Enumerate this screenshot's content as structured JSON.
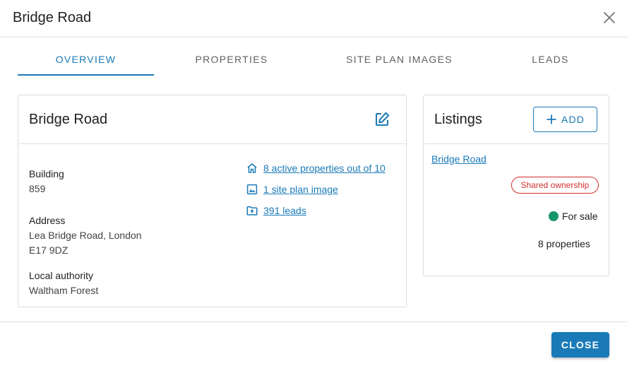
{
  "dialog": {
    "title": "Bridge Road",
    "close_icon": "close-icon"
  },
  "tabs": [
    {
      "label": "OVERVIEW",
      "active": true
    },
    {
      "label": "PROPERTIES",
      "active": false
    },
    {
      "label": "SITE PLAN IMAGES",
      "active": false
    },
    {
      "label": "LEADS",
      "active": false
    }
  ],
  "overview": {
    "title": "Bridge Road",
    "edit_icon": "edit-icon",
    "fields": {
      "building_label": "Building",
      "building_value": "859",
      "address_label": "Address",
      "address_line1": "Lea Bridge Road, London",
      "address_line2": "E17 9DZ",
      "authority_label": "Local authority",
      "authority_value": "Waltham Forest"
    },
    "links": [
      {
        "icon": "home-icon",
        "text": "8 active properties out of 10"
      },
      {
        "icon": "image-icon",
        "text": "1 site plan image"
      },
      {
        "icon": "folder-icon",
        "text": "391 leads"
      }
    ]
  },
  "listings": {
    "title": "Listings",
    "add_label": "ADD",
    "add_icon": "plus-icon",
    "item": {
      "name": "Bridge Road",
      "badge": "Shared ownership",
      "status": "For sale",
      "status_color": "#16956e",
      "count": "8 properties"
    }
  },
  "footer": {
    "close_label": "CLOSE"
  },
  "colors": {
    "accent": "#1a7ab8",
    "badge": "#d32f2f"
  }
}
